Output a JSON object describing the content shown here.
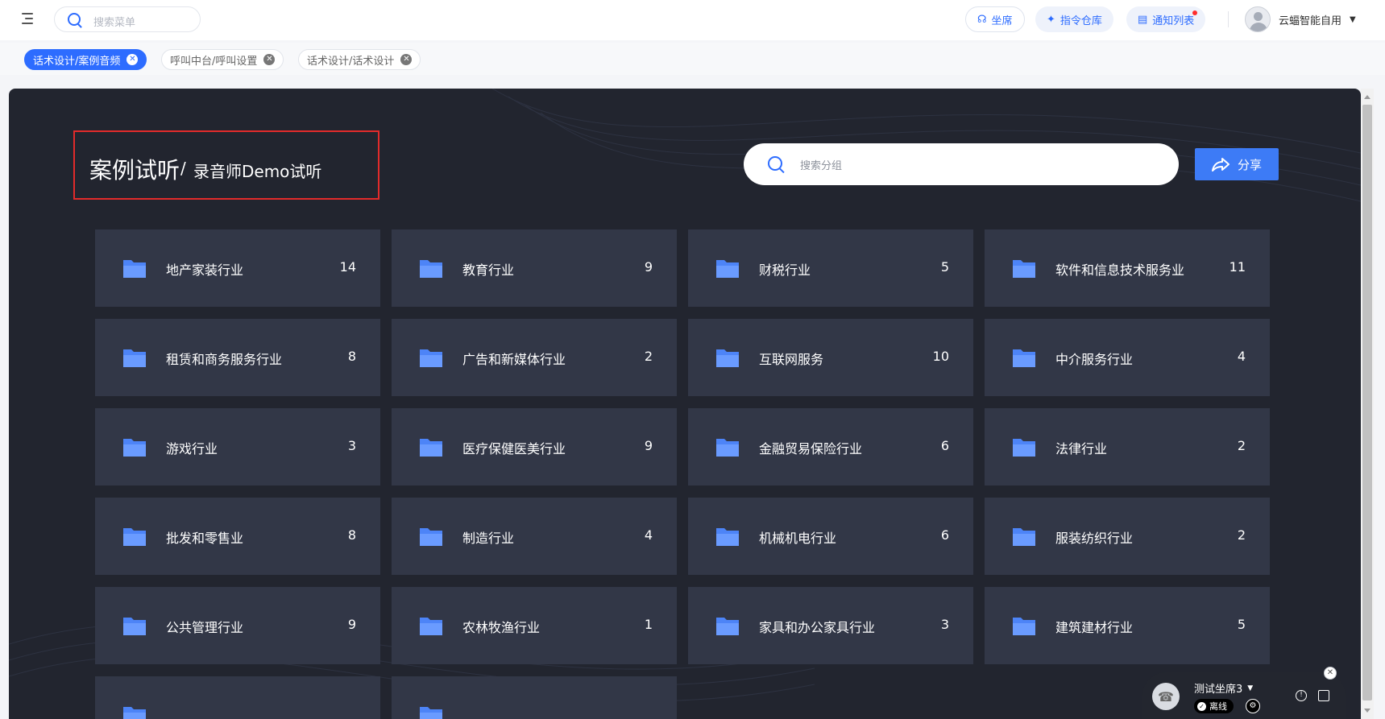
{
  "header": {
    "search_placeholder": "搜索菜单",
    "buttons": [
      {
        "label": "坐席",
        "icon": "headset-icon"
      },
      {
        "label": "指令仓库",
        "icon": "pin-icon"
      },
      {
        "label": "通知列表",
        "icon": "document-icon"
      }
    ],
    "user_name": "云蝠智能自用"
  },
  "tabs": [
    {
      "label": "话术设计/案例音频",
      "active": true
    },
    {
      "label": "呼叫中台/呼叫设置",
      "active": false
    },
    {
      "label": "话术设计/话术设计",
      "active": false
    }
  ],
  "page": {
    "title": "案例试听",
    "separator": "/",
    "subtitle": "录音师Demo试听",
    "search_placeholder": "搜索分组",
    "share_label": "分享"
  },
  "groups": [
    {
      "name": "地产家装行业",
      "count": "14"
    },
    {
      "name": "教育行业",
      "count": "9"
    },
    {
      "name": "财税行业",
      "count": "5"
    },
    {
      "name": "软件和信息技术服务业",
      "count": "11"
    },
    {
      "name": "租赁和商务服务行业",
      "count": "8"
    },
    {
      "name": "广告和新媒体行业",
      "count": "2"
    },
    {
      "name": "互联网服务",
      "count": "10"
    },
    {
      "name": "中介服务行业",
      "count": "4"
    },
    {
      "name": "游戏行业",
      "count": "3"
    },
    {
      "name": "医疗保健医美行业",
      "count": "9"
    },
    {
      "name": "金融贸易保险行业",
      "count": "6"
    },
    {
      "name": "法律行业",
      "count": "2"
    },
    {
      "name": "批发和零售业",
      "count": "8"
    },
    {
      "name": "制造行业",
      "count": "4"
    },
    {
      "name": "机械机电行业",
      "count": "6"
    },
    {
      "name": "服装纺织行业",
      "count": "2"
    },
    {
      "name": "公共管理行业",
      "count": "9"
    },
    {
      "name": "农林牧渔行业",
      "count": "1"
    },
    {
      "name": "家具和办公家具行业",
      "count": "3"
    },
    {
      "name": "建筑建材行业",
      "count": "5"
    },
    {
      "name": "",
      "count": ""
    },
    {
      "name": "",
      "count": ""
    }
  ],
  "call_widget": {
    "agent_name": "测试坐席3",
    "status": "离线"
  },
  "colors": {
    "accent": "#2d6cff",
    "panel_bg": "#22252f",
    "card_bg": "#323747",
    "folder": "#4d84f7",
    "title_box_border": "#e22b2b"
  }
}
